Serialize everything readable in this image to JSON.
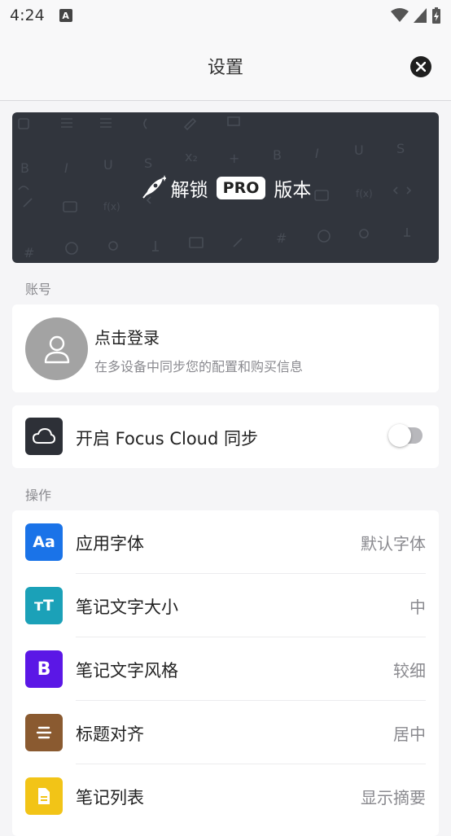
{
  "status": {
    "time": "4:24",
    "notif_letter": "A"
  },
  "header": {
    "title": "设置"
  },
  "banner": {
    "unlock": "解锁",
    "pro": "PRO",
    "edition": "版本"
  },
  "account": {
    "section_label": "账号",
    "login_title": "点击登录",
    "login_subtitle": "在多设备中同步您的配置和购买信息"
  },
  "cloud": {
    "label": "开启 Focus Cloud 同步",
    "enabled": false
  },
  "operations": {
    "section_label": "操作",
    "rows": [
      {
        "label": "应用字体",
        "value": "默认字体",
        "icon": "font-icon",
        "icon_text": "Aa",
        "color": "#1a73e8"
      },
      {
        "label": "笔记文字大小",
        "value": "中",
        "icon": "text-size-icon",
        "icon_text": "тT",
        "color": "#1ba1b8"
      },
      {
        "label": "笔记文字风格",
        "value": "较细",
        "icon": "bold-icon",
        "icon_text": "B",
        "color": "#5b17e6"
      },
      {
        "label": "标题对齐",
        "value": "居中",
        "icon": "align-center-icon",
        "icon_text": "",
        "color": "#8a5a30"
      },
      {
        "label": "笔记列表",
        "value": "显示摘要",
        "icon": "document-icon",
        "icon_text": "",
        "color": "#f2c417"
      }
    ]
  }
}
